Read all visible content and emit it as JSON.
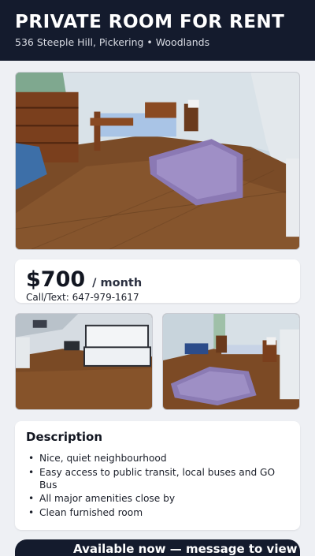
{
  "header": {
    "title": "PRIVATE ROOM FOR RENT",
    "subtitle": "536 Steeple Hill, Pickering • Woodlands"
  },
  "price": {
    "amount": "$700",
    "period": "/ month",
    "contact": "Call/Text: 647-979-1617"
  },
  "description": {
    "title": "Description",
    "items": [
      "Nice, quiet neighbourhood",
      "Easy access to public transit, local buses and GO Bus",
      "All major amenities close by",
      "Clean furnished room"
    ]
  },
  "cta": {
    "label": "Available now — message to view"
  },
  "colors": {
    "header_bg": "#141b2d",
    "page_bg": "#eef0f4",
    "card_bg": "#ffffff",
    "text": "#1b1f2a"
  },
  "photos": [
    {
      "name": "main-room-photo",
      "depicts": "room with wooden bed, dresser, chair and purple rug on hardwood floor"
    },
    {
      "name": "bunk-bed-photo",
      "depicts": "room with bunk bed on hardwood floor"
    },
    {
      "name": "room-rug-photo",
      "depicts": "room with bed, chair and purple rug"
    }
  ]
}
